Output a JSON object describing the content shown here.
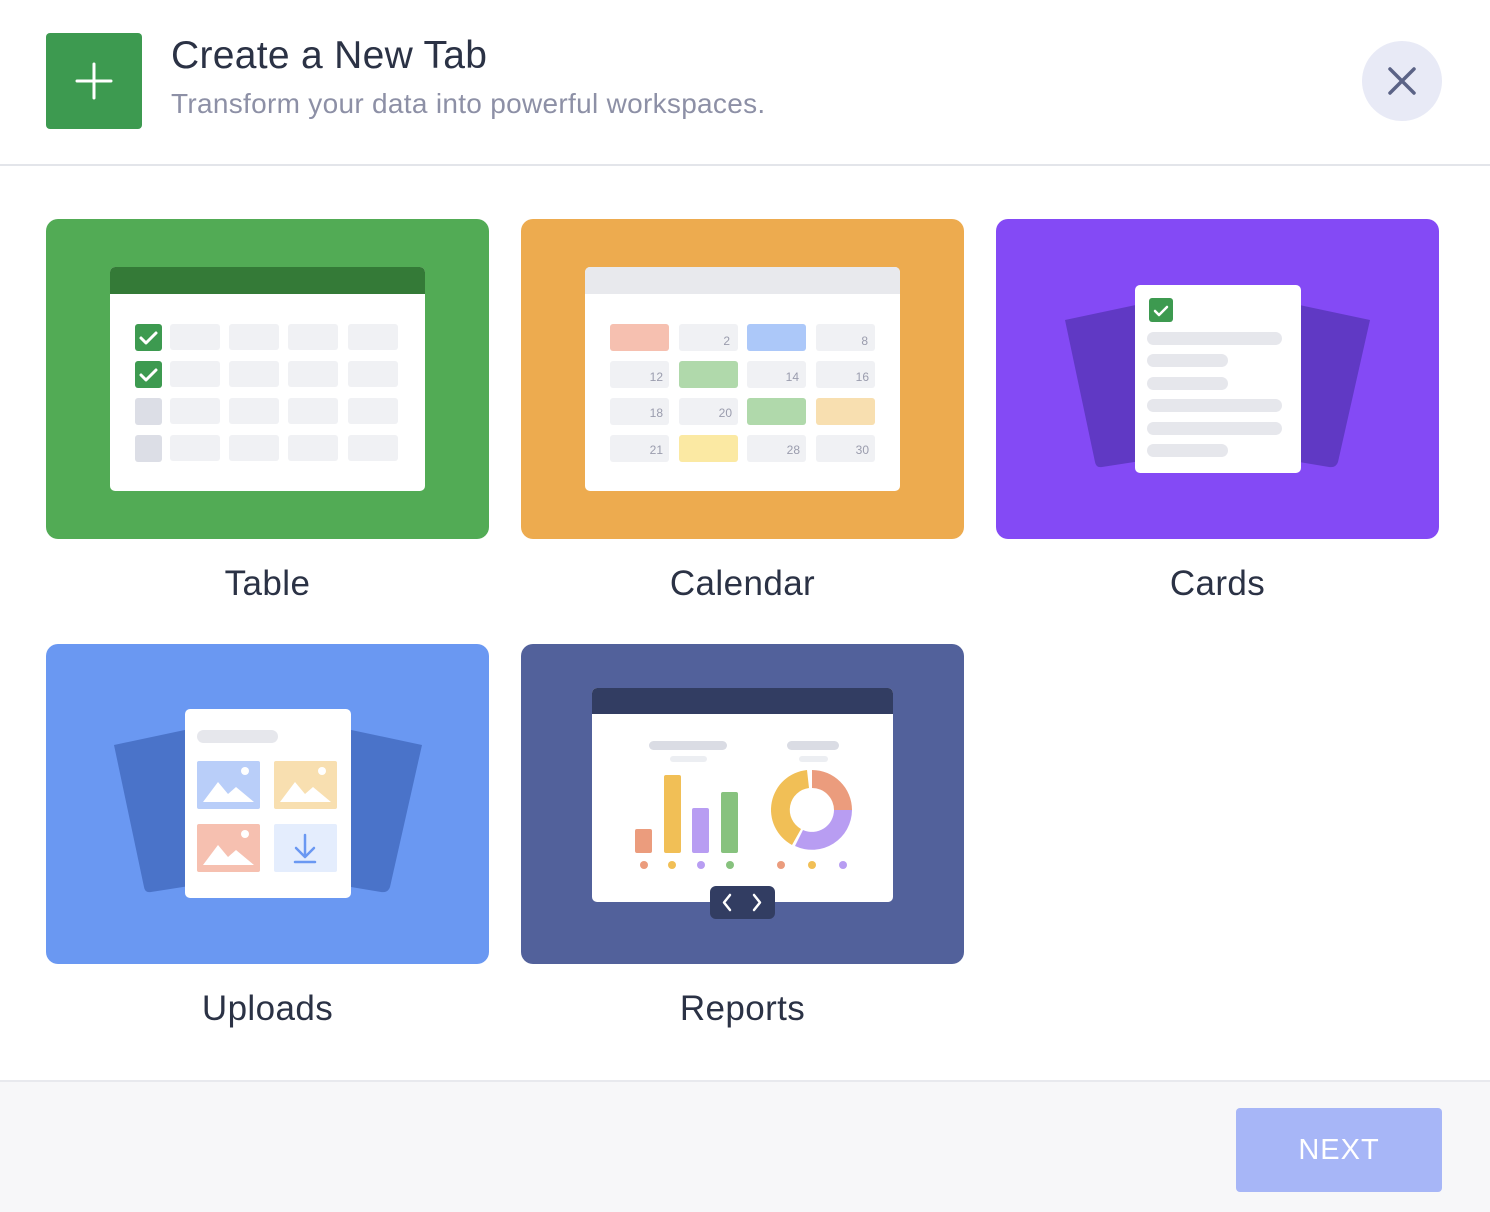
{
  "header": {
    "title": "Create a New Tab",
    "subtitle": "Transform your data into powerful workspaces.",
    "icon": "plus-icon",
    "close_icon": "close-icon"
  },
  "options": [
    {
      "label": "Table",
      "color": "#52ab55"
    },
    {
      "label": "Calendar",
      "color": "#edab4f"
    },
    {
      "label": "Cards",
      "color": "#844af5"
    },
    {
      "label": "Uploads",
      "color": "#6a98f2"
    },
    {
      "label": "Reports",
      "color": "#52619b"
    }
  ],
  "calendar_days": [
    "2",
    "8",
    "12",
    "14",
    "16",
    "18",
    "20",
    "21",
    "28",
    "30"
  ],
  "footer": {
    "next_label": "NEXT"
  },
  "colors": {
    "accent": "#3d9a50",
    "next_disabled": "#a7b6f7"
  }
}
